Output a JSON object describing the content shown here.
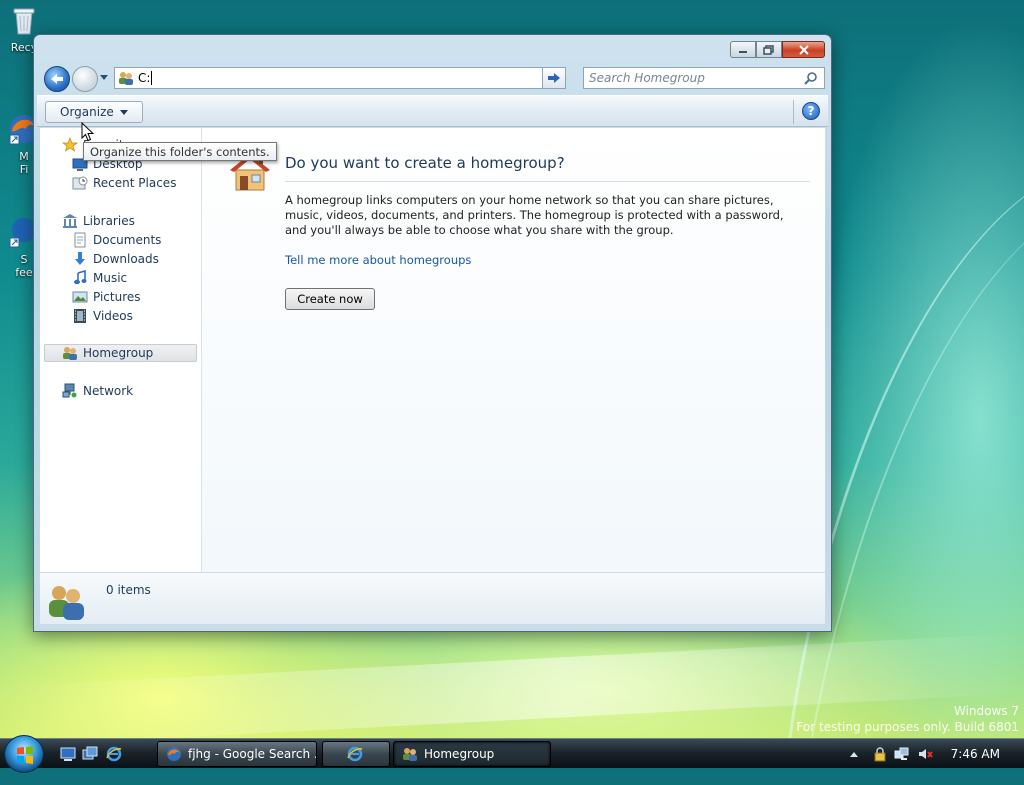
{
  "desktop": {
    "icons": [
      {
        "label": "Recy"
      },
      {
        "label": "M\nFi"
      },
      {
        "label": "S\nfee"
      }
    ]
  },
  "window": {
    "address": {
      "value": "C:"
    },
    "search": {
      "placeholder": "Search Homegroup"
    },
    "toolbar": {
      "organize": "Organize"
    },
    "tooltip": "Organize this folder's contents.",
    "nav": {
      "favorites": "Favorites",
      "desktop": "Desktop",
      "recent": "Recent Places",
      "libraries": "Libraries",
      "documents": "Documents",
      "downloads": "Downloads",
      "music": "Music",
      "pictures": "Pictures",
      "videos": "Videos",
      "homegroup": "Homegroup",
      "network": "Network"
    },
    "content": {
      "title": "Do you want to create a homegroup?",
      "description": "A homegroup links computers on your home network so that you can share pictures, music, videos, documents, and printers. The homegroup is protected with a password, and you'll always be able to choose what you share with the group.",
      "link": "Tell me more about homegroups",
      "button": "Create now"
    },
    "status": {
      "items": "0 items"
    }
  },
  "watermark": {
    "line1": "Windows 7",
    "line2": "For testing purposes only. Build 6801"
  },
  "taskbar": {
    "firefox": "fjhg - Google Search ...",
    "homegroup": "Homegroup",
    "clock": "7:46 AM"
  },
  "colors": {
    "link": "#1a56a6",
    "title": "#1e395b",
    "close": "#c84125"
  }
}
